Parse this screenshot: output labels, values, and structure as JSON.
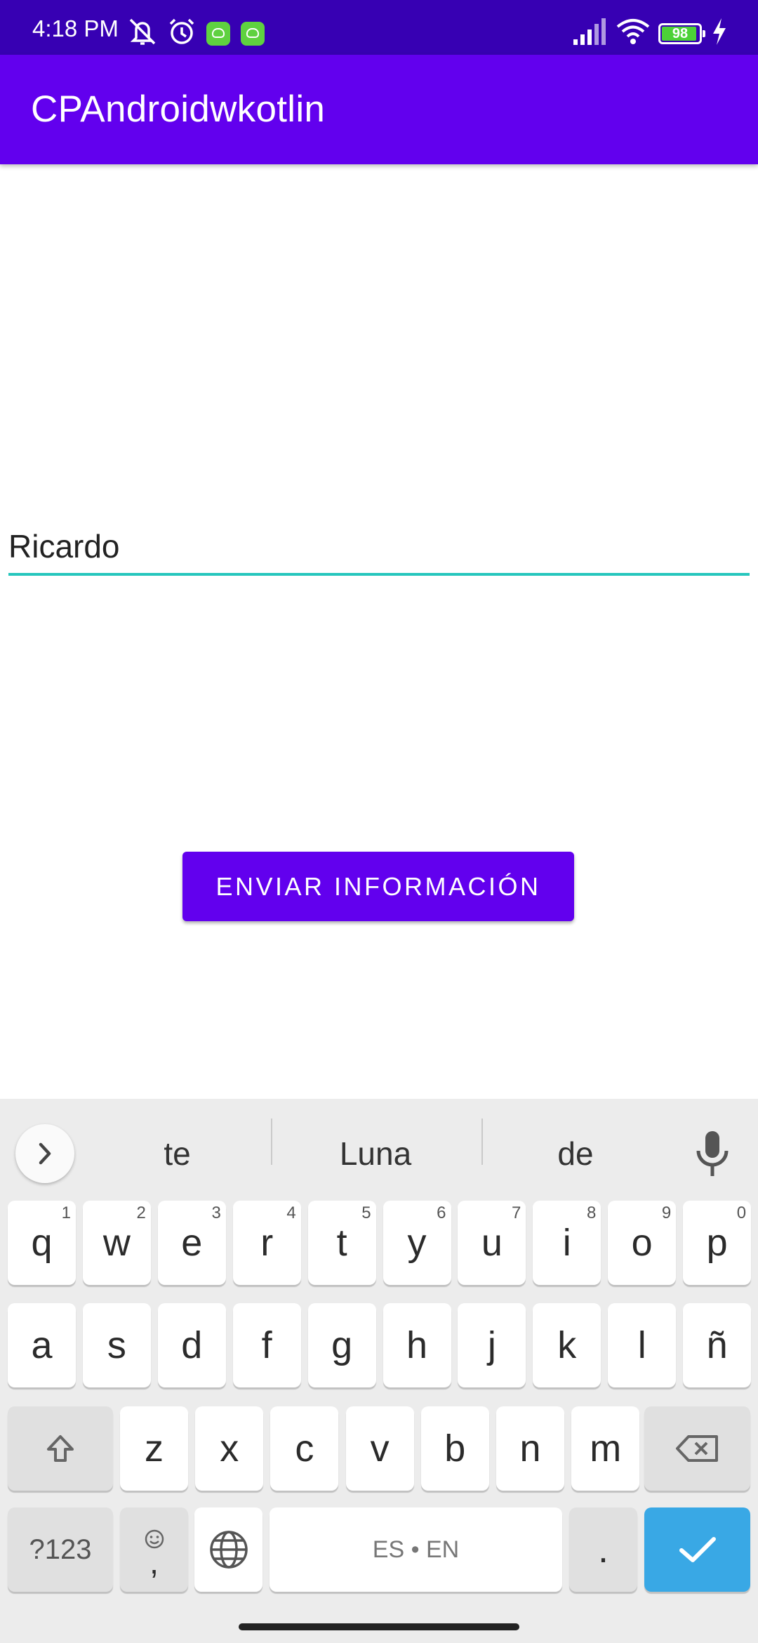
{
  "status_bar": {
    "time": "4:18 PM",
    "battery": "98",
    "icons": [
      "mute-icon",
      "alarm-icon",
      "app-notification-icon",
      "app-notification-icon",
      "signal-icon",
      "wifi-icon",
      "battery-icon",
      "charging-icon"
    ]
  },
  "app_bar": {
    "title": "CPAndroidwkotlin"
  },
  "form": {
    "name_value": "Ricardo",
    "send_button_label": "ENVIAR INFORMACIÓN"
  },
  "colors": {
    "status_bar": "#3700B3",
    "primary": "#6200EE",
    "input_underline": "#26C6BD",
    "keyboard_bg": "#ECECEC",
    "enter_key": "#39A8E5"
  },
  "keyboard": {
    "suggestions": [
      "te",
      "Luna",
      "de"
    ],
    "row1": [
      {
        "k": "q",
        "h": "1"
      },
      {
        "k": "w",
        "h": "2"
      },
      {
        "k": "e",
        "h": "3"
      },
      {
        "k": "r",
        "h": "4"
      },
      {
        "k": "t",
        "h": "5"
      },
      {
        "k": "y",
        "h": "6"
      },
      {
        "k": "u",
        "h": "7"
      },
      {
        "k": "i",
        "h": "8"
      },
      {
        "k": "o",
        "h": "9"
      },
      {
        "k": "p",
        "h": "0"
      }
    ],
    "row2": [
      "a",
      "s",
      "d",
      "f",
      "g",
      "h",
      "j",
      "k",
      "l",
      "ñ"
    ],
    "row3": [
      "z",
      "x",
      "c",
      "v",
      "b",
      "n",
      "m"
    ],
    "symbols_label": "?123",
    "comma_label": ",",
    "space_label": "ES • EN",
    "period_label": "."
  }
}
